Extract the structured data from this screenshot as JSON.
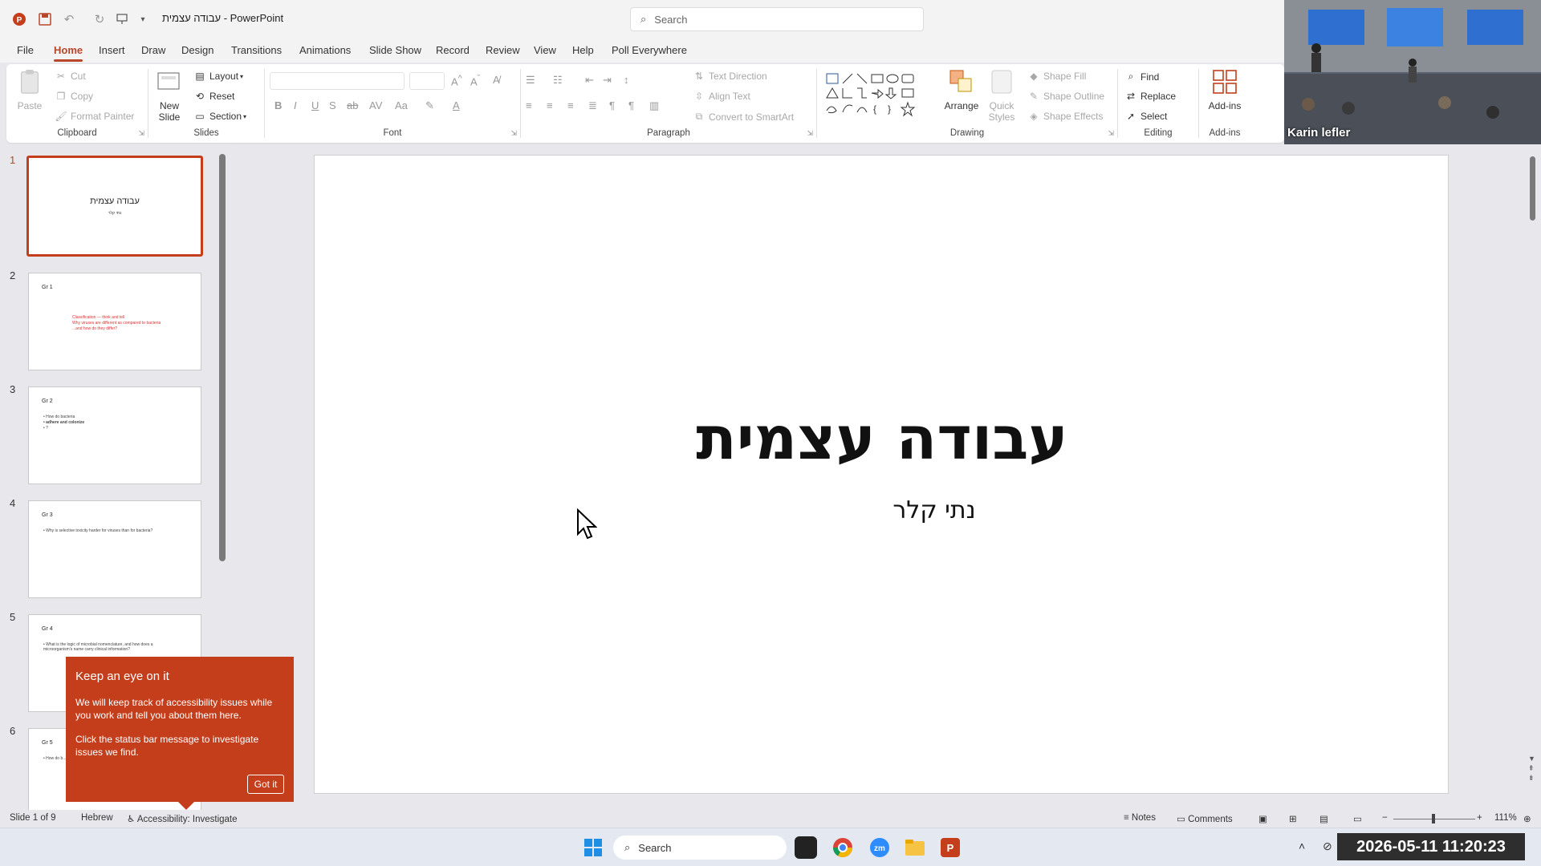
{
  "app": {
    "title": "עבודה עצמית  -  PowerPoint"
  },
  "search": {
    "placeholder": "Search"
  },
  "menu": {
    "tabs": [
      "File",
      "Home",
      "Insert",
      "Draw",
      "Design",
      "Transitions",
      "Animations",
      "Slide Show",
      "Record",
      "Review",
      "View",
      "Help",
      "Poll Everywhere"
    ],
    "active": "Home"
  },
  "ribbon": {
    "clipboard": {
      "label": "Clipboard",
      "paste": "Paste",
      "cut": "Cut",
      "copy": "Copy",
      "format_painter": "Format Painter"
    },
    "slides": {
      "label": "Slides",
      "new_slide": "New Slide",
      "layout": "Layout",
      "reset": "Reset",
      "section": "Section"
    },
    "font": {
      "label": "Font"
    },
    "paragraph": {
      "label": "Paragraph",
      "text_direction": "Text Direction",
      "align_text": "Align Text",
      "convert_smartart": "Convert to SmartArt"
    },
    "drawing": {
      "label": "Drawing",
      "arrange": "Arrange",
      "quick_styles": "Quick Styles",
      "shape_fill": "Shape Fill",
      "shape_outline": "Shape Outline",
      "shape_effects": "Shape Effects"
    },
    "editing": {
      "label": "Editing",
      "find": "Find",
      "replace": "Replace",
      "select": "Select"
    },
    "addins": {
      "label": "Add-ins",
      "button": "Add-ins"
    }
  },
  "video": {
    "participant": "Karin lefler"
  },
  "thumbnails": [
    {
      "num": "1",
      "title": "עבודה עצמית",
      "lines": [
        "נתי קלר"
      ]
    },
    {
      "num": "2",
      "title": "Gr 1",
      "lines": [
        "Classification — think and tell",
        "Why viruses are different as compared to bacteria",
        "...and how do they differ?"
      ]
    },
    {
      "num": "3",
      "title": "Gr 2",
      "lines": [
        "• How do bacteria",
        "• adhere and colonize",
        "• ?"
      ]
    },
    {
      "num": "4",
      "title": "Gr 3",
      "lines": [
        "• Why is selective toxicity harder for viruses than for bacteria?"
      ]
    },
    {
      "num": "5",
      "title": "Gr 4",
      "lines": [
        "• What is the logic of microbial nomenclature, and how does a",
        "  microorganism's name carry clinical information?"
      ]
    },
    {
      "num": "6",
      "title": "Gr 5",
      "lines": [
        "• How do b..."
      ]
    }
  ],
  "slide": {
    "title": "עבודה עצמית",
    "subtitle": "נתי קלר"
  },
  "tip": {
    "title": "Keep an eye on it",
    "body1": "We will keep track of accessibility issues while you work and tell you about them here.",
    "body2": "Click the status bar message to investigate issues we find.",
    "button": "Got it"
  },
  "status": {
    "slide_count": "Slide 1 of 9",
    "language": "Hebrew",
    "accessibility": "Accessibility: Investigate",
    "notes": "Notes",
    "comments": "Comments",
    "zoom": "111%"
  },
  "taskbar": {
    "search": "Search",
    "clock": "2026-05-11 11:20:23"
  },
  "colors": {
    "accent": "#c43e1c",
    "tab_active": "#b7472a"
  }
}
